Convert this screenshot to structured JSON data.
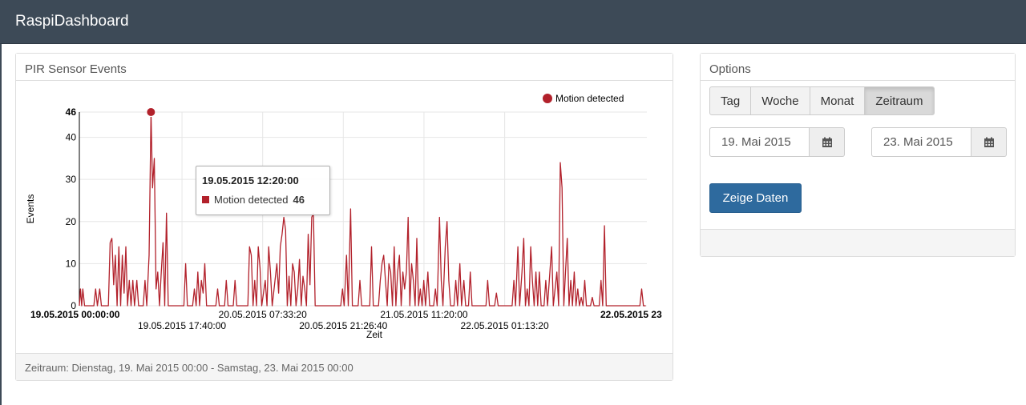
{
  "app": {
    "title": "RaspiDashboard"
  },
  "chart_panel": {
    "heading": "PIR Sensor Events",
    "footer": "Zeitraum: Dienstag, 19. Mai 2015 00:00 - Samstag, 23. Mai 2015 00:00"
  },
  "tooltip": {
    "title": "19.05.2015 12:20:00",
    "series": "Motion detected",
    "value": "46"
  },
  "options": {
    "heading": "Options",
    "buttons": [
      "Tag",
      "Woche",
      "Monat",
      "Zeitraum"
    ],
    "active_button": "Zeitraum",
    "date_from": "19. Mai 2015",
    "date_to": "23. Mai 2015",
    "submit_label": "Zeige Daten"
  },
  "colors": {
    "navbar": "#3d4a57",
    "series": "#b2212b",
    "primary_button": "#2e6a9e"
  },
  "chart_data": {
    "type": "line",
    "xlabel": "Zeit",
    "ylabel": "Events",
    "ylim": [
      0,
      46
    ],
    "y_ticks": [
      0,
      10,
      20,
      30,
      40,
      46
    ],
    "x_range_hours": [
      0,
      97.7
    ],
    "x_tick_labels": [
      {
        "label": "19.05.2015 00:00:00",
        "hour": 0,
        "bold": true
      },
      {
        "label": "19.05.2015 17:40:00",
        "hour": 17.67,
        "bold": false
      },
      {
        "label": "20.05.2015 07:33:20",
        "hour": 31.56,
        "bold": false
      },
      {
        "label": "20.05.2015 21:26:40",
        "hour": 45.44,
        "bold": false
      },
      {
        "label": "21.05.2015 11:20:00",
        "hour": 59.33,
        "bold": false
      },
      {
        "label": "22.05.2015 01:13:20",
        "hour": 73.22,
        "bold": false
      },
      {
        "label": "22.05.2015 23",
        "hour": 97.5,
        "bold": true
      }
    ],
    "legend": {
      "position": "top-right",
      "label": "Motion detected"
    },
    "grid": true,
    "highlight": {
      "hour": 12.33,
      "value": 46
    },
    "series": [
      {
        "name": "Motion detected",
        "points": [
          [
            0,
            0
          ],
          [
            0.2,
            4
          ],
          [
            0.4,
            0
          ],
          [
            0.6,
            4
          ],
          [
            0.9,
            0
          ],
          [
            2.5,
            0
          ],
          [
            2.8,
            4
          ],
          [
            3.1,
            0
          ],
          [
            3.5,
            4
          ],
          [
            3.8,
            0
          ],
          [
            5.0,
            0
          ],
          [
            5.3,
            15
          ],
          [
            5.6,
            16
          ],
          [
            5.9,
            5
          ],
          [
            6.2,
            12
          ],
          [
            6.5,
            0
          ],
          [
            6.8,
            14
          ],
          [
            7.1,
            0
          ],
          [
            7.4,
            12
          ],
          [
            7.7,
            3
          ],
          [
            8.0,
            14
          ],
          [
            8.3,
            0
          ],
          [
            8.6,
            6
          ],
          [
            8.9,
            0
          ],
          [
            9.2,
            6
          ],
          [
            9.5,
            0
          ],
          [
            9.9,
            6
          ],
          [
            10.2,
            0
          ],
          [
            11.0,
            0
          ],
          [
            11.3,
            6
          ],
          [
            11.6,
            0
          ],
          [
            12.0,
            12
          ],
          [
            12.33,
            46
          ],
          [
            12.6,
            28
          ],
          [
            12.9,
            35
          ],
          [
            13.2,
            4
          ],
          [
            13.5,
            8
          ],
          [
            13.8,
            0
          ],
          [
            14.1,
            8
          ],
          [
            14.4,
            15
          ],
          [
            14.7,
            0
          ],
          [
            15.0,
            22
          ],
          [
            15.3,
            0
          ],
          [
            18.0,
            0
          ],
          [
            18.3,
            10
          ],
          [
            18.6,
            0
          ],
          [
            19.5,
            0
          ],
          [
            19.8,
            4
          ],
          [
            20.1,
            0
          ],
          [
            20.4,
            8
          ],
          [
            20.7,
            0
          ],
          [
            21.0,
            6
          ],
          [
            21.3,
            3
          ],
          [
            21.6,
            10
          ],
          [
            21.9,
            0
          ],
          [
            23.5,
            0
          ],
          [
            23.8,
            4
          ],
          [
            24.1,
            0
          ],
          [
            25.0,
            0
          ],
          [
            25.3,
            6
          ],
          [
            25.6,
            0
          ],
          [
            26.5,
            0
          ],
          [
            26.8,
            6
          ],
          [
            27.1,
            0
          ],
          [
            29.0,
            0
          ],
          [
            29.3,
            14
          ],
          [
            29.6,
            12
          ],
          [
            29.9,
            0
          ],
          [
            30.2,
            6
          ],
          [
            30.5,
            0
          ],
          [
            30.8,
            14
          ],
          [
            31.1,
            9
          ],
          [
            31.4,
            0
          ],
          [
            32.0,
            6
          ],
          [
            32.3,
            0
          ],
          [
            32.6,
            14
          ],
          [
            32.9,
            8
          ],
          [
            33.2,
            0
          ],
          [
            34.0,
            10
          ],
          [
            34.3,
            3
          ],
          [
            34.6,
            14
          ],
          [
            34.9,
            17
          ],
          [
            35.2,
            21
          ],
          [
            35.5,
            18
          ],
          [
            35.8,
            0
          ],
          [
            36.1,
            7
          ],
          [
            36.4,
            0
          ],
          [
            36.7,
            10
          ],
          [
            37.0,
            8
          ],
          [
            37.3,
            0
          ],
          [
            37.6,
            4
          ],
          [
            37.9,
            11
          ],
          [
            38.2,
            0
          ],
          [
            38.5,
            7
          ],
          [
            38.8,
            4
          ],
          [
            39.1,
            0
          ],
          [
            39.4,
            17
          ],
          [
            39.7,
            5
          ],
          [
            40.0,
            21
          ],
          [
            40.3,
            22
          ],
          [
            40.6,
            0
          ],
          [
            41.0,
            0
          ],
          [
            45.0,
            0
          ],
          [
            45.3,
            4
          ],
          [
            45.6,
            0
          ],
          [
            46.0,
            12
          ],
          [
            46.3,
            0
          ],
          [
            46.7,
            23
          ],
          [
            47.0,
            0
          ],
          [
            48.0,
            0
          ],
          [
            48.3,
            6
          ],
          [
            48.6,
            0
          ],
          [
            50.0,
            0
          ],
          [
            50.3,
            14
          ],
          [
            50.6,
            0
          ],
          [
            51.5,
            0
          ],
          [
            51.8,
            6
          ],
          [
            52.1,
            10
          ],
          [
            52.4,
            12
          ],
          [
            52.7,
            6
          ],
          [
            53.0,
            0
          ],
          [
            53.3,
            10
          ],
          [
            53.6,
            8
          ],
          [
            53.9,
            0
          ],
          [
            54.2,
            14
          ],
          [
            54.5,
            0
          ],
          [
            54.8,
            8
          ],
          [
            55.1,
            12
          ],
          [
            55.4,
            0
          ],
          [
            55.7,
            8
          ],
          [
            56.0,
            4
          ],
          [
            56.3,
            8
          ],
          [
            56.6,
            21
          ],
          [
            56.9,
            0
          ],
          [
            57.2,
            10
          ],
          [
            57.5,
            6
          ],
          [
            57.8,
            0
          ],
          [
            58.1,
            16
          ],
          [
            58.4,
            0
          ],
          [
            58.7,
            4
          ],
          [
            59.0,
            0
          ],
          [
            59.3,
            6
          ],
          [
            59.6,
            0
          ],
          [
            60.0,
            8
          ],
          [
            60.3,
            0
          ],
          [
            61.0,
            0
          ],
          [
            61.3,
            4
          ],
          [
            61.6,
            0
          ],
          [
            62.0,
            21
          ],
          [
            62.3,
            6
          ],
          [
            62.6,
            0
          ],
          [
            63.0,
            14
          ],
          [
            63.3,
            20
          ],
          [
            63.6,
            6
          ],
          [
            63.9,
            0
          ],
          [
            64.5,
            0
          ],
          [
            64.8,
            6
          ],
          [
            65.1,
            0
          ],
          [
            65.5,
            10
          ],
          [
            65.8,
            0
          ],
          [
            66.2,
            6
          ],
          [
            66.5,
            0
          ],
          [
            67.0,
            0
          ],
          [
            67.3,
            8
          ],
          [
            67.6,
            0
          ],
          [
            70.0,
            0
          ],
          [
            70.3,
            6
          ],
          [
            70.6,
            0
          ],
          [
            71.5,
            0
          ],
          [
            71.8,
            3
          ],
          [
            72.1,
            0
          ],
          [
            74.5,
            0
          ],
          [
            74.8,
            6
          ],
          [
            75.1,
            0
          ],
          [
            75.5,
            14
          ],
          [
            75.8,
            0
          ],
          [
            76.2,
            8
          ],
          [
            76.5,
            16
          ],
          [
            76.8,
            0
          ],
          [
            77.1,
            4
          ],
          [
            77.4,
            0
          ],
          [
            77.7,
            14
          ],
          [
            78.0,
            6
          ],
          [
            78.3,
            0
          ],
          [
            78.6,
            8
          ],
          [
            78.9,
            0
          ],
          [
            79.2,
            8
          ],
          [
            79.5,
            0
          ],
          [
            80.0,
            0
          ],
          [
            80.3,
            6
          ],
          [
            80.6,
            0
          ],
          [
            81.0,
            8
          ],
          [
            81.3,
            14
          ],
          [
            81.6,
            0
          ],
          [
            81.9,
            4
          ],
          [
            82.2,
            8
          ],
          [
            82.5,
            0
          ],
          [
            82.8,
            34
          ],
          [
            83.1,
            28
          ],
          [
            83.4,
            0
          ],
          [
            83.7,
            8
          ],
          [
            84.0,
            16
          ],
          [
            84.3,
            0
          ],
          [
            84.6,
            6
          ],
          [
            84.9,
            0
          ],
          [
            85.2,
            8
          ],
          [
            85.5,
            0
          ],
          [
            85.8,
            4
          ],
          [
            86.1,
            0
          ],
          [
            86.4,
            2
          ],
          [
            86.7,
            0
          ],
          [
            87.0,
            6
          ],
          [
            87.3,
            0
          ],
          [
            88.0,
            0
          ],
          [
            88.3,
            2
          ],
          [
            88.6,
            0
          ],
          [
            89.5,
            0
          ],
          [
            89.8,
            6
          ],
          [
            90.1,
            0
          ],
          [
            90.4,
            19
          ],
          [
            90.7,
            0
          ],
          [
            92.0,
            0
          ],
          [
            96.5,
            0
          ],
          [
            96.8,
            4
          ],
          [
            97.1,
            0
          ],
          [
            97.5,
            0
          ]
        ]
      }
    ]
  }
}
